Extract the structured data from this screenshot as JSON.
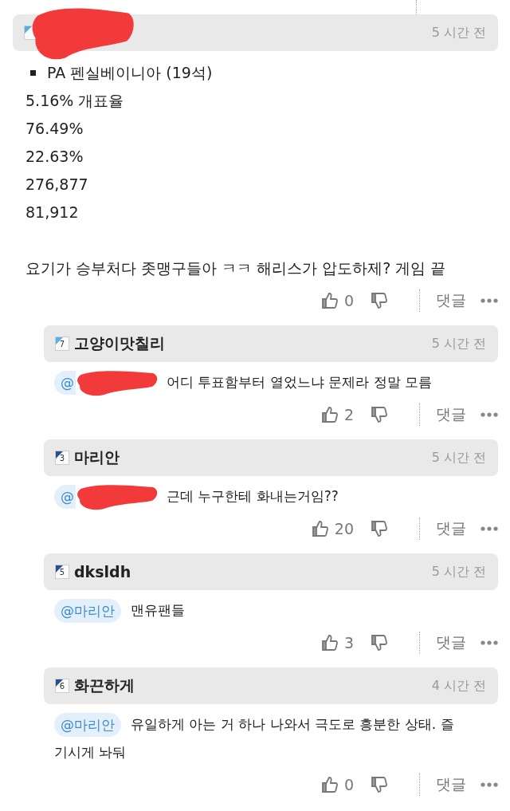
{
  "post": {
    "author": {
      "redacted": true,
      "color": "#5aaee0"
    },
    "time": "5 시간 전",
    "bullet": "PA 펜실베이니아 (19석)",
    "lines": [
      "5.16% 개표율",
      "76.49%",
      "22.63%",
      "276,877",
      "81,912"
    ],
    "text": "요기가 승부처다 좃맹구들아 ㅋㅋ 해리스가 압도하제? 게임 끝",
    "likes": "0",
    "reply_label": "댓글"
  },
  "replies": [
    {
      "author": "고양이맛칠리",
      "rank": "7",
      "color": "#5aaee0",
      "time": "5 시간 전",
      "mention": {
        "text": "@",
        "redacted": true
      },
      "text": [
        "어디 투표함부터 열었느냐 문제라 정말 모름"
      ],
      "likes": "2",
      "reply_label": "댓글"
    },
    {
      "author": "마리안",
      "rank": "3",
      "color": "#2a4f8f",
      "time": "5 시간 전",
      "mention": {
        "text": "@",
        "redacted": true
      },
      "text": [
        "근데 누구한테 화내는거임??"
      ],
      "likes": "20",
      "reply_label": "댓글"
    },
    {
      "author": "dksldh",
      "rank": "5",
      "color": "#2a4f8f",
      "time": "5 시간 전",
      "mention": {
        "text": "@마리안"
      },
      "text": [
        "맨유팬들"
      ],
      "likes": "3",
      "reply_label": "댓글"
    },
    {
      "author": "화끈하게",
      "rank": "6",
      "color": "#2a4f8f",
      "time": "4 시간 전",
      "mention": {
        "text": "@마리안"
      },
      "text": [
        "유일하게 아는 거 하나 나와서 극도로 흥분한 상태. 즐",
        "기시게 놔둬"
      ],
      "likes": "0",
      "reply_label": "댓글"
    }
  ]
}
